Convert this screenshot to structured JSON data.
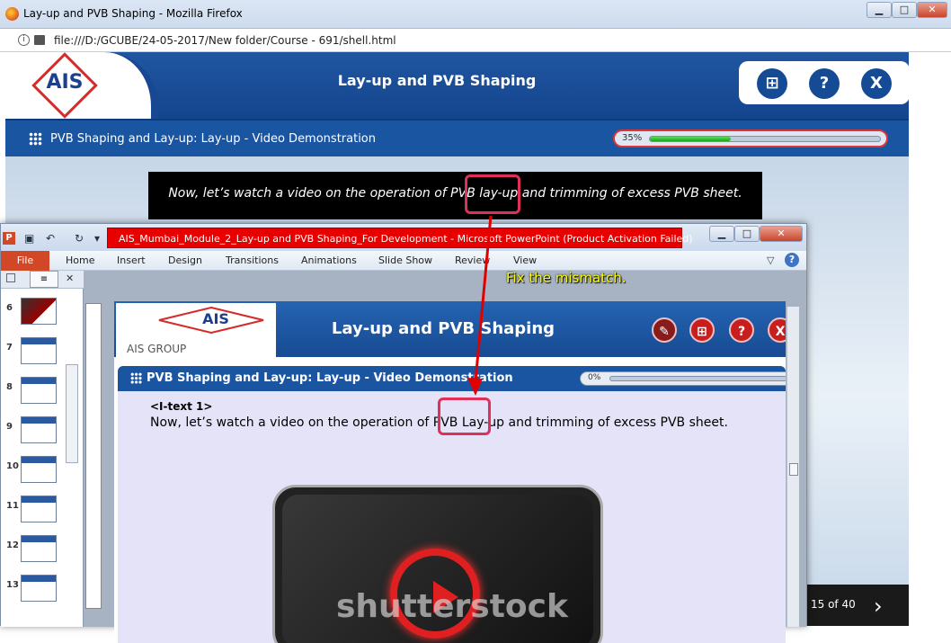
{
  "firefox": {
    "title": "Lay-up and PVB Shaping - Mozilla Firefox",
    "url": "file:///D:/GCUBE/24-05-2017/New folder/Course - 691/shell.html",
    "minimize": "▁",
    "maximize": "□",
    "close": "✕"
  },
  "course": {
    "logo_text": "AIS",
    "title": "Lay-up and PVB Shaping",
    "subtitle": "PVB Shaping and Lay-up: Lay-up - Video Demonstration",
    "progress_label": "35%",
    "progress_value": 0.35,
    "caption": "Now, let’s watch a video on the operation of PVB lay-up and trimming of excess PVB sheet.",
    "page_counter": "15 of 40",
    "buttons": {
      "sitemap": "⊞",
      "help": "?",
      "exit": "X"
    }
  },
  "powerpoint": {
    "title": "AIS_Mumbai_Module_2_Lay-up and PVB Shaping_For Development  -  Microsoft PowerPoint (Product Activation Failed)",
    "tabs": [
      "File",
      "Home",
      "Insert",
      "Design",
      "Transitions",
      "Animations",
      "Slide Show",
      "Review",
      "View"
    ],
    "thumbnails": [
      "6",
      "7",
      "8",
      "9",
      "10",
      "11",
      "12",
      "13"
    ],
    "slide": {
      "logo_text": "AIS",
      "logo_sub": "AIS GROUP",
      "title": "Lay-up and PVB Shaping",
      "subtitle": "PVB Shaping and Lay-up: Lay-up - Video Demonstration",
      "progress_label": "0%",
      "itext_label": "<I-text 1>",
      "text": "Now, let’s watch a video on the operation of PVB Lay-up and trimming of excess PVB sheet.",
      "watermark": "shutterstock"
    }
  },
  "annotation": {
    "note": "Fix the mismatch.",
    "colors": {
      "highlight": "#e0305a",
      "note": "#ffff00",
      "arrow": "#e00000"
    }
  }
}
